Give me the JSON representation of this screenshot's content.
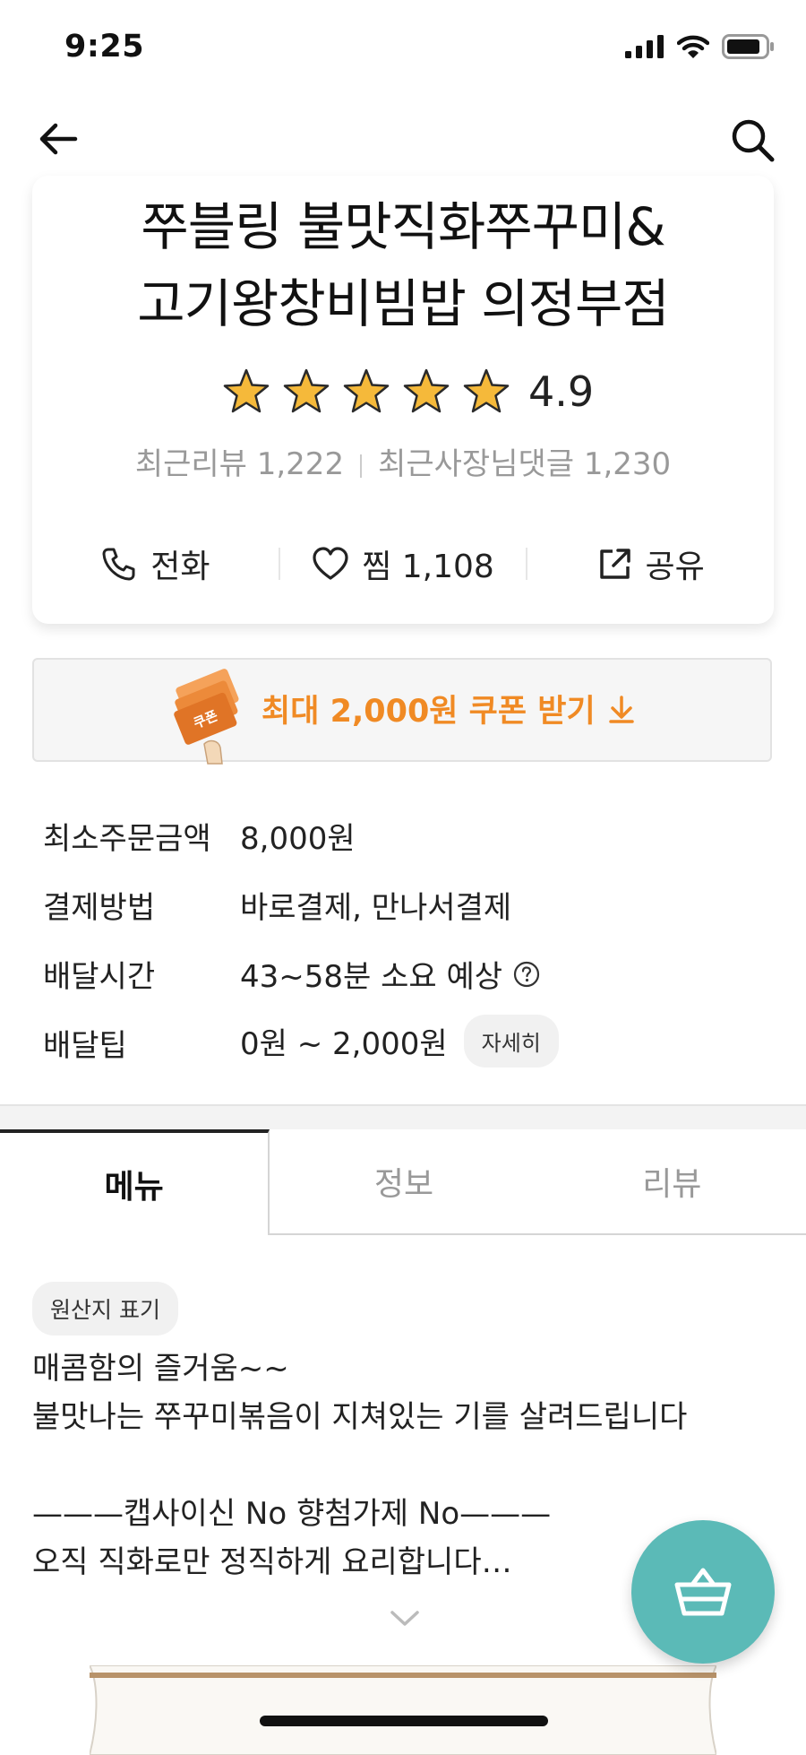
{
  "status_bar": {
    "time": "9:25"
  },
  "store": {
    "title_line1": "쭈블링 불맛직화쭈꾸미&",
    "title_line2": "고기왕창비빔밥 의정부점",
    "rating": "4.9",
    "stars": 5,
    "recent_reviews": "최근리뷰 1,222",
    "owner_replies": "최근사장님댓글 1,230"
  },
  "actions": {
    "call": "전화",
    "like": "찜 1,108",
    "share": "공유"
  },
  "coupon": {
    "badge": "쿠폰",
    "text": "최대 2,000원 쿠폰 받기"
  },
  "info": [
    {
      "label": "최소주문금액",
      "value": "8,000원"
    },
    {
      "label": "결제방법",
      "value": "바로결제, 만나서결제"
    },
    {
      "label": "배달시간",
      "value": "43~58분 소요 예상"
    },
    {
      "label": "배달팁",
      "value": "0원 ~ 2,000원",
      "button": "자세히"
    }
  ],
  "tabs": [
    {
      "label": "메뉴",
      "active": true
    },
    {
      "label": "정보",
      "active": false
    },
    {
      "label": "리뷰",
      "active": false
    }
  ],
  "origin_chip": "원산지 표기",
  "description": "매콤함의 즐거움~~\n불맛나는 쭈꾸미볶음이 지쳐있는 기를 살려드립니다\n\n———캡사이신 No 향첨가제 No———\n오직 직화로만 정직하게 요리합니다…",
  "colors": {
    "accent": "#f08a24",
    "cart": "#5bbab7",
    "star": "#f5b93a"
  },
  "icons": [
    "back-arrow-icon",
    "search-icon",
    "star-icon",
    "phone-icon",
    "heart-icon",
    "share-icon",
    "download-icon",
    "help-icon",
    "chevron-down-icon",
    "basket-icon"
  ]
}
